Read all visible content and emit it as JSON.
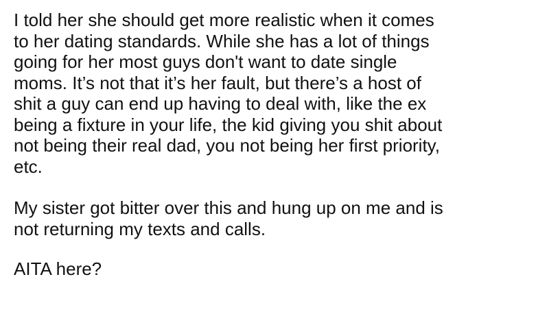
{
  "post": {
    "paragraphs": [
      {
        "lines": [
          "I told her she should get more realistic when it comes",
          "to her dating standards. While she has a lot of things",
          "going for her most guys don't want to date single",
          "moms. It’s not that it’s her fault, but there’s a host of",
          "shit a guy can end up having to deal with, like the ex",
          "being a fixture in your life, the kid giving you shit about",
          "not being their real dad, you not being her first priority,",
          "etc."
        ]
      },
      {
        "lines": [
          "My sister got bitter over this and hung up on me and is",
          "not returning my texts and calls."
        ]
      },
      {
        "lines": [
          "AITA here?"
        ]
      }
    ]
  }
}
